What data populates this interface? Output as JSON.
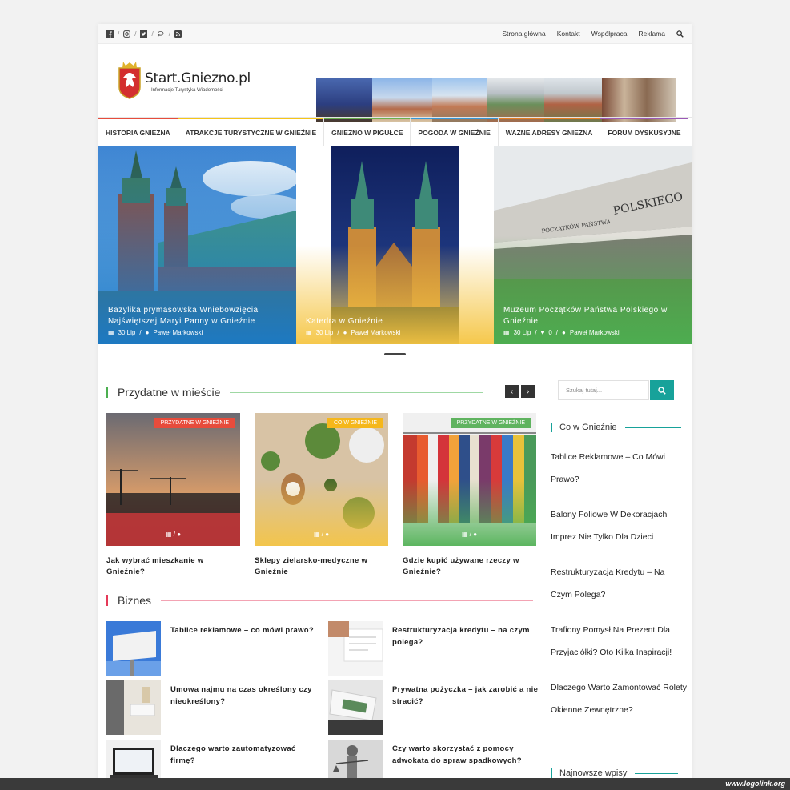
{
  "topbar": {
    "nav": [
      "Strona główna",
      "Kontakt",
      "Współpraca",
      "Reklama"
    ]
  },
  "logo": {
    "title": "Start.Gniezno.pl",
    "subtitle": "Informacje Turystyka Wiadomości"
  },
  "mainnav": [
    {
      "label": "HISTORIA GNIEZNA",
      "color": "#e74c3c"
    },
    {
      "label": "ATRAKCJE TURYSTYCZNE W GNIEŹNIE",
      "color": "#f5c518"
    },
    {
      "label": "GNIEZNO W PIGUŁCE",
      "color": "#6ab04c"
    },
    {
      "label": "POGODA W GNIEŹNIE",
      "color": "#3498db"
    },
    {
      "label": "WAŻNE ADRESY GNIEZNA",
      "color": "#e67e22"
    },
    {
      "label": "FORUM DYSKUSYJNE",
      "color": "#9b59b6"
    }
  ],
  "slides": [
    {
      "title": "Bazylika prymasowska Wniebowzięcia Najświętszej Maryi Panny w Gnieźnie",
      "date": "30 Lip",
      "comments": "",
      "author": "Paweł Markowski"
    },
    {
      "title": "Katedra w Gnieźnie",
      "date": "30 Lip",
      "comments": "",
      "author": "Paweł Markowski"
    },
    {
      "title": "Muzeum Początków Państwa Polskiego w Gnieźnie",
      "date": "30 Lip",
      "comments": "0",
      "author": "Paweł Markowski"
    }
  ],
  "section1": {
    "title": "Przydatne w mieście"
  },
  "cards": [
    {
      "badge": "PRZYDATNE W GNIEŹNIE",
      "badge_color": "#e74c3c",
      "title": "Jak wybrać mieszkanie w Gnieźnie?"
    },
    {
      "badge": "CO W GNIEŹNIE",
      "badge_color": "#f5b71b",
      "title": "Sklepy zielarsko-medyczne w Gnieźnie"
    },
    {
      "badge": "PRZYDATNE W GNIEŹNIE",
      "badge_color": "#5fb35f",
      "title": "Gdzie kupić używane rzeczy w Gnieźnie?"
    }
  ],
  "section2": {
    "title": "Biznes"
  },
  "biznes": [
    "Tablice reklamowe – co mówi prawo?",
    "Restrukturyzacja kredytu – na czym polega?",
    "Umowa najmu na czas określony czy nieokreślony?",
    "Prywatna pożyczka – jak zarobić a nie stracić?",
    "Dlaczego warto zautomatyzować firmę?",
    "Czy warto skorzystać z pomocy adwokata do spraw spadkowych?"
  ],
  "sidebar": {
    "search_placeholder": "Szukaj tutaj...",
    "widget_title": "Co w Gnieźnie",
    "links": [
      "Tablice Reklamowe – Co Mówi Prawo?",
      "Balony Foliowe W Dekoracjach Imprez Nie Tylko Dla Dzieci",
      "Restrukturyzacja Kredytu – Na Czym Polega?",
      "Trafiony Pomysł Na Prezent Dla Przyjaciółki? Oto Kilka Inspiracji!",
      "Dlaczego Warto Zamontować Rolety Okienne Zewnętrzne?"
    ],
    "widget2_title": "Najnowsze wpisy"
  },
  "watermark": "www.logolink.org",
  "colors": {
    "accent": "#17a29a",
    "section1": "#4caf50",
    "section2": "#e53958"
  }
}
